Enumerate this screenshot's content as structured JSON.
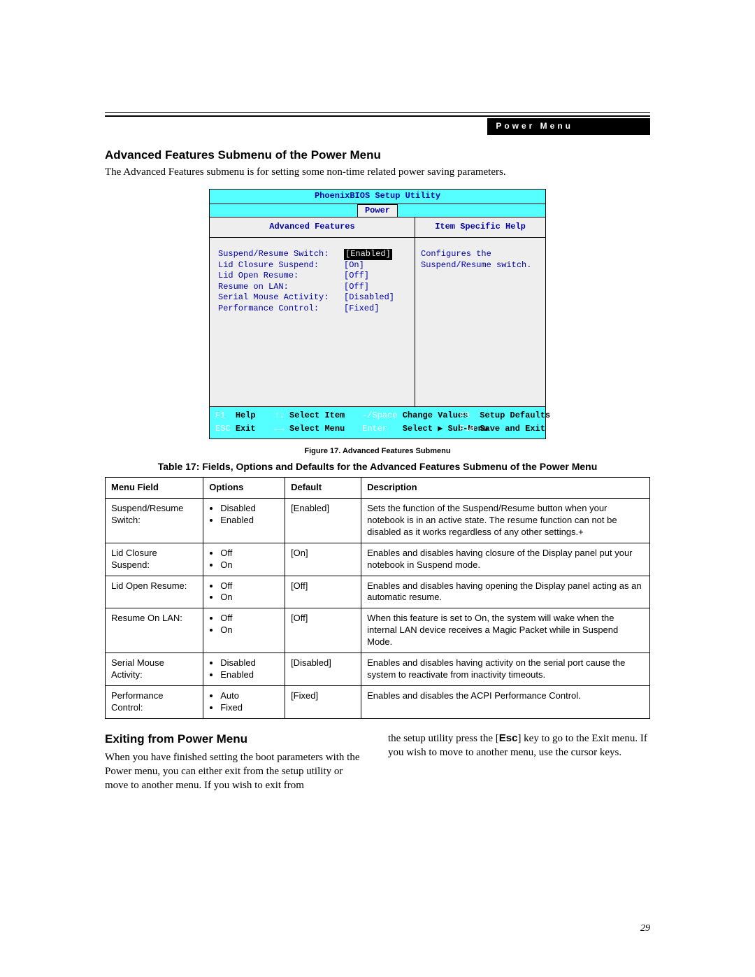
{
  "header_tab": "Power Menu",
  "section1_title": "Advanced Features Submenu of the Power Menu",
  "section1_intro": "The Advanced Features submenu is for setting some non-time related power saving parameters.",
  "bios": {
    "title": "PhoenixBIOS Setup Utility",
    "menu_tab": "Power",
    "panel_title": "Advanced Features",
    "help_title": "Item Specific Help",
    "help_body": "Configures the Suspend/Resume switch.",
    "rows": [
      {
        "label": "Suspend/Resume Switch:",
        "value": "[Enabled]",
        "selected": true
      },
      {
        "label": "Lid Closure Suspend:",
        "value": "[On]",
        "selected": false
      },
      {
        "label": "Lid Open Resume:",
        "value": "[Off]",
        "selected": false
      },
      {
        "label": "Resume on LAN:",
        "value": "[Off]",
        "selected": false
      },
      {
        "label": "Serial Mouse Activity:",
        "value": "[Disabled]",
        "selected": false
      },
      {
        "label": "Performance Control:",
        "value": "[Fixed]",
        "selected": false
      }
    ],
    "footer": {
      "f1": "F1",
      "help": "Help",
      "arrows_v": "↑↓",
      "select_item": "Select Item",
      "minus_space": "-/Space",
      "change_values": "Change Values",
      "f9": "F9",
      "setup_defaults": "Setup Defaults",
      "esc": "ESC",
      "exit": "Exit",
      "arrows_h": "←→",
      "select_menu": "Select Menu",
      "enter": "Enter",
      "select_sub": "Select ▶ Sub-Menu",
      "f10": "F10",
      "save_exit": "Save and Exit"
    }
  },
  "figure_caption": "Figure 17.  Advanced Features Submenu",
  "table_caption": "Table 17: Fields, Options and Defaults for the Advanced Features Submenu of the Power Menu",
  "table_headers": {
    "c1": "Menu Field",
    "c2": "Options",
    "c3": "Default",
    "c4": "Description"
  },
  "table_rows": [
    {
      "field": "Suspend/Resume Switch:",
      "options": [
        "Disabled",
        "Enabled"
      ],
      "default": "[Enabled]",
      "desc": "Sets the function of the Suspend/Resume button when your notebook is in an active state. The resume function can not be disabled as it works regardless of any other settings.+"
    },
    {
      "field": "Lid Closure Suspend:",
      "options": [
        "Off",
        "On"
      ],
      "default": "[On]",
      "desc": "Enables and disables having closure of the Display panel put your notebook in Suspend mode."
    },
    {
      "field": "Lid Open Resume:",
      "options": [
        "Off",
        "On"
      ],
      "default": "[Off]",
      "desc": "Enables and disables having opening the Display panel acting as an automatic resume."
    },
    {
      "field": "Resume On LAN:",
      "options": [
        "Off",
        "On"
      ],
      "default": "[Off]",
      "desc": "When this feature is set to On, the system will wake when the internal LAN device receives a Magic Packet while in Suspend Mode."
    },
    {
      "field": "Serial Mouse Activity:",
      "options": [
        "Disabled",
        "Enabled"
      ],
      "default": "[Disabled]",
      "desc": "Enables and disables having activity on the serial port cause the system to reactivate from inactivity timeouts."
    },
    {
      "field": "Performance Control:",
      "options": [
        "Auto",
        "Fixed"
      ],
      "default": "[Fixed]",
      "desc": "Enables and disables the ACPI Performance Control."
    }
  ],
  "section2_title": "Exiting from Power Menu",
  "bottom_col1": "When you have finished setting the boot parameters with the Power menu, you can either exit from the setup utility or move to another menu. If you wish to exit from",
  "bottom_col2_a": "the setup utility press the [",
  "bottom_col2_key": "Esc",
  "bottom_col2_b": "] key to go to the Exit menu. If you wish to move to another menu, use the cursor keys.",
  "page_number": "29"
}
